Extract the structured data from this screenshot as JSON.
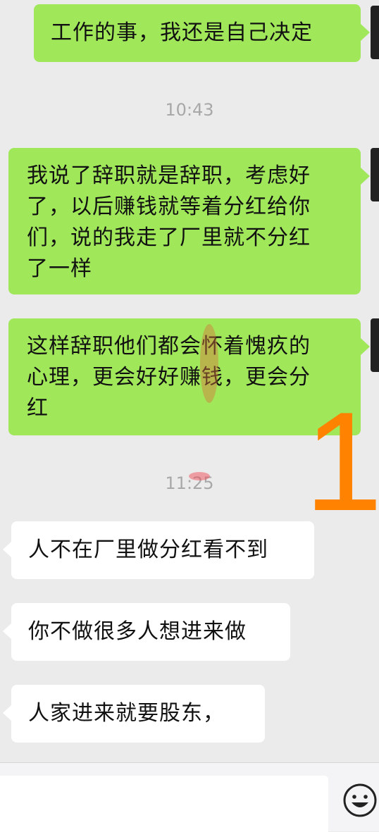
{
  "messages": [
    {
      "id": "m1",
      "direction": "sent",
      "lines": [
        "工作的事，我还是自己决定"
      ]
    },
    {
      "id": "m2",
      "direction": "sent",
      "lines": [
        "我说了辞职就是辞职，考虑好",
        "了，以后赚钱就等着分红给你",
        "们，说的我走了厂里就不分红",
        "了一样"
      ]
    },
    {
      "id": "m3",
      "direction": "sent",
      "lines": [
        "这样辞职他们都会怀着愧疚的",
        "心理，更会好好赚钱，更会分",
        "红"
      ]
    },
    {
      "id": "m4",
      "direction": "received",
      "lines": [
        "人不在厂里做分红看不到"
      ]
    },
    {
      "id": "m5",
      "direction": "received",
      "lines": [
        "你不做很多人想进来做"
      ]
    },
    {
      "id": "m6",
      "direction": "received",
      "lines": [
        "人家进来就要股东，"
      ]
    }
  ],
  "timestamps": {
    "t1": "10:43",
    "t2": "11:25"
  },
  "annotation": {
    "label": "1",
    "color": "#ff8200"
  },
  "colors": {
    "sent_bubble": "#a0e75a",
    "received_bubble": "#ffffff",
    "background": "#ebebeb"
  },
  "input_bar": {
    "value": "",
    "emoji_icon": "smiley-face-icon"
  }
}
